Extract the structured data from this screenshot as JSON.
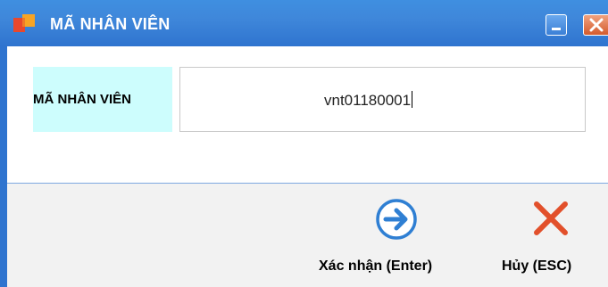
{
  "window": {
    "title": "MÃ NHÂN VIÊN",
    "icon": "app-logo-icon",
    "controls": {
      "minimize_icon": "minimize-icon",
      "close_icon": "close-icon"
    }
  },
  "form": {
    "employee_code_label": "MÃ NHÂN VIÊN",
    "employee_code_value": "vnt01180001"
  },
  "actions": {
    "confirm_label": "Xác nhận (Enter)",
    "confirm_icon": "arrow-right-circle-icon",
    "cancel_label": "Hủy (ESC)",
    "cancel_icon": "x-cross-icon"
  },
  "colors": {
    "titlebar": "#3f87da",
    "label_background": "#cdfdfd",
    "confirm_icon": "#2f7fd3",
    "cancel_icon": "#e2502b"
  }
}
